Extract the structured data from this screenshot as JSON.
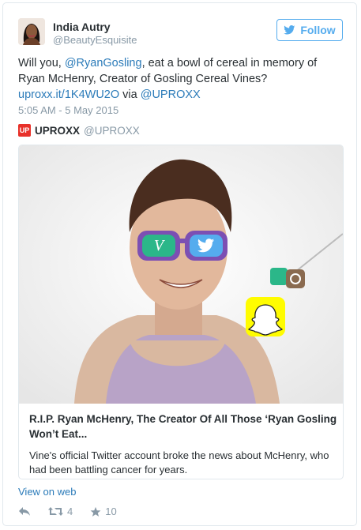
{
  "author": {
    "name": "India Autry",
    "handle": "@BeautyEsquisite"
  },
  "follow_button": {
    "label": "Follow"
  },
  "tweet": {
    "text_1": "Will you, ",
    "mention_1": "@RyanGosling",
    "text_2": ", eat a bowl of cereal in memory of Ryan McHenry, Creator of Gosling Cereal Vines? ",
    "link": "uproxx.it/1K4WU2O",
    "text_3": " via ",
    "mention_2": "@UPROXX",
    "timestamp": "5:05 AM - 5 May 2015"
  },
  "source": {
    "logo_text": "UP",
    "name": "UPROXX",
    "handle": "@UPROXX"
  },
  "card": {
    "title": "R.I.P. Ryan McHenry, The Creator Of All Those ‘Ryan Gosling Won’t Eat...",
    "description": "Vine's official Twitter account broke the news about McHenry, who had been battling cancer for years.",
    "image_icons": [
      "vine-icon",
      "twitter-icon",
      "instagram-icon",
      "snapchat-icon"
    ]
  },
  "footer": {
    "view_on_web": "View on web",
    "retweet_count": "4",
    "favorite_count": "10"
  },
  "colors": {
    "twitter_blue": "#55acee",
    "link_blue": "#2b7bb9",
    "muted_gray": "#8899a6",
    "uproxx_red": "#e8312a",
    "snapchat_yellow": "#fffc00"
  }
}
